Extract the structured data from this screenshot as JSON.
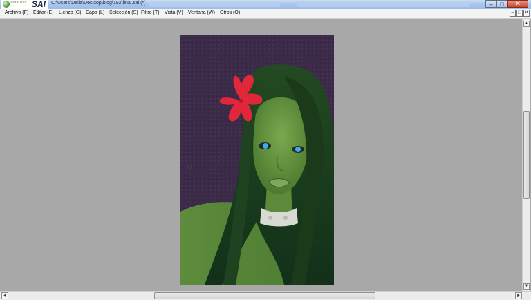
{
  "app": {
    "title_path": "C:\\Users\\Delia\\Desktop\\blog\\192\\final.sai (*)",
    "logo_small": "PaintTool",
    "logo_big": "SAI"
  },
  "menu": [
    {
      "label": "Archivo (F)"
    },
    {
      "label": "Editar (E)"
    },
    {
      "label": "Lienzo (C)"
    },
    {
      "label": "Capa (L)"
    },
    {
      "label": "Selección (S)"
    },
    {
      "label": "Filtro (T)"
    },
    {
      "label": "Vista (V)"
    },
    {
      "label": "Ventana (W)"
    },
    {
      "label": "Otros (O)"
    }
  ],
  "window_controls": {
    "minimize": "–",
    "maximize": "□",
    "close": "✕"
  },
  "mdi_controls": {
    "minimize": "–",
    "restore": "□",
    "close": "✕"
  },
  "scroll": {
    "up": "▲",
    "down": "▼",
    "left": "◄",
    "right": "►"
  },
  "colors": {
    "canvas_bg": "#a8a8a8",
    "art_bg": "#3b2a48",
    "skin": "#5f8f3f",
    "hair": "#1a3a1a",
    "flower": "#e0283a"
  }
}
